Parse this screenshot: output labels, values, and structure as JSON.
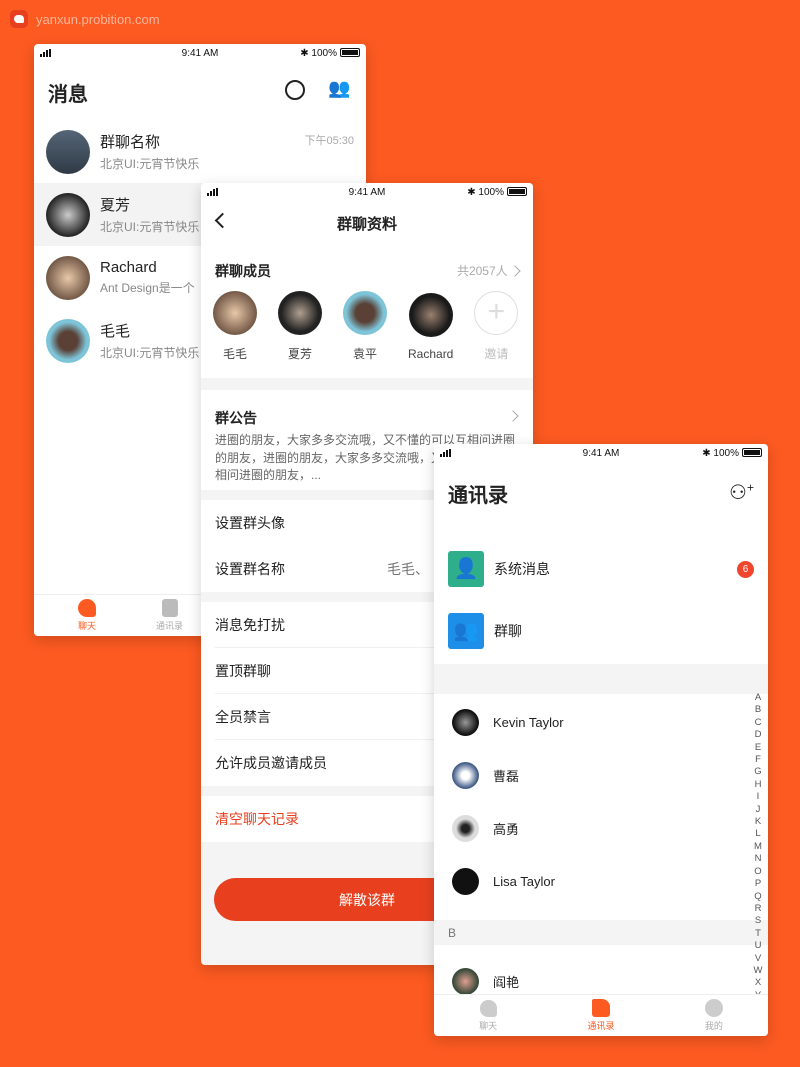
{
  "watermark": "yanxun.probition.com",
  "status": {
    "time": "9:41 AM",
    "battery": "100%"
  },
  "messages": {
    "title": "消息",
    "items": [
      {
        "name": "群聊名称",
        "preview": "北京UI:元宵节快乐",
        "time": "下午05:30"
      },
      {
        "name": "夏芳",
        "preview": "北京UI:元宵节快乐",
        "time": ""
      },
      {
        "name": "Rachard",
        "preview": "Ant Design是一个",
        "time": ""
      },
      {
        "name": "毛毛",
        "preview": "北京UI:元宵节快乐",
        "time": ""
      }
    ],
    "tabs": [
      {
        "label": "聊天"
      },
      {
        "label": "通讯录"
      }
    ]
  },
  "group_info": {
    "title": "群聊资料",
    "members_label": "群聊成员",
    "members_count": "共2057人",
    "members": [
      {
        "name": "毛毛"
      },
      {
        "name": "夏芳"
      },
      {
        "name": "袁平"
      },
      {
        "name": "Rachard"
      }
    ],
    "invite_label": "邀请",
    "notice_label": "群公告",
    "notice_text": "进圈的朋友，大家多多交流哦，又不懂的可以互相问进圈的朋友，进圈的朋友，大家多多交流哦，又不懂的可以互相问进圈的朋友，...",
    "settings": [
      {
        "label": "设置群头像",
        "value": ""
      },
      {
        "label": "设置群名称",
        "value": "毛毛、"
      }
    ],
    "toggles": [
      {
        "label": "消息免打扰"
      },
      {
        "label": "置顶群聊"
      },
      {
        "label": "全员禁言"
      },
      {
        "label": "允许成员邀请成员"
      }
    ],
    "clear_label": "清空聊天记录",
    "dissolve_label": "解散该群"
  },
  "contacts": {
    "title": "通讯录",
    "system": [
      {
        "label": "系统消息",
        "badge": "6",
        "color": "#2fae8c"
      },
      {
        "label": "群聊",
        "badge": "",
        "color": "#1e8fe8"
      }
    ],
    "list_a": [
      {
        "name": "Kevin Taylor"
      },
      {
        "name": "曹磊"
      },
      {
        "name": "高勇"
      },
      {
        "name": "Lisa Taylor"
      }
    ],
    "section_b": "B",
    "list_b": [
      {
        "name": "阎艳"
      }
    ],
    "index": [
      "A",
      "B",
      "C",
      "D",
      "E",
      "F",
      "G",
      "H",
      "I",
      "J",
      "K",
      "L",
      "M",
      "N",
      "O",
      "P",
      "Q",
      "R",
      "S",
      "T",
      "U",
      "V",
      "W",
      "X",
      "Y"
    ],
    "tabs": [
      {
        "label": "聊天"
      },
      {
        "label": "通讯录"
      },
      {
        "label": "我的"
      }
    ]
  },
  "colors": {
    "accent": "#fc5a21",
    "danger": "#e8401f",
    "badge": "#f0462d"
  }
}
